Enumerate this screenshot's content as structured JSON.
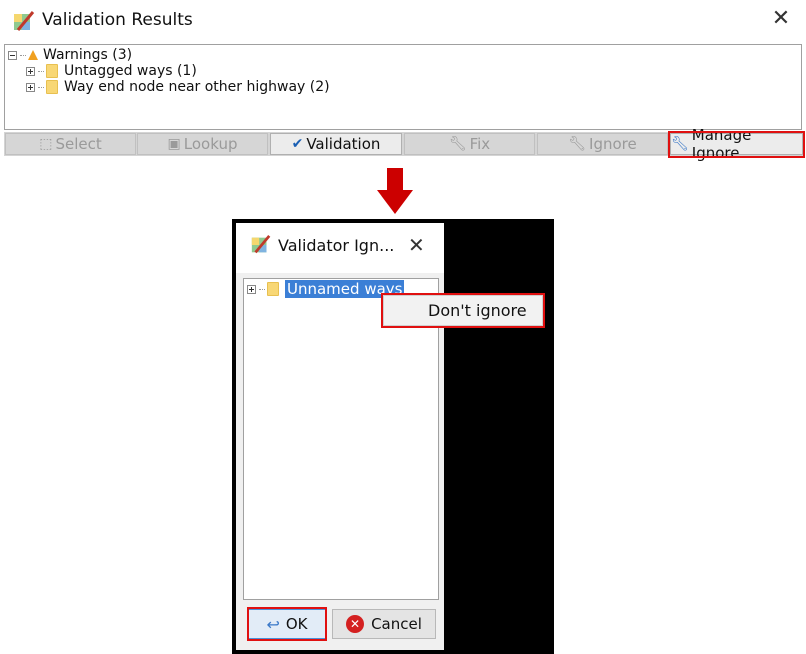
{
  "validation_window": {
    "title": "Validation Results",
    "close_icon": "close-icon",
    "tree": {
      "root": {
        "label": "Warnings (3)",
        "icon": "warning-icon",
        "expanded": true
      },
      "children": [
        {
          "label": "Untagged ways (1)",
          "icon": "folder-icon",
          "expanded": false
        },
        {
          "label": "Way end node near other highway (2)",
          "icon": "folder-icon",
          "expanded": false
        }
      ]
    },
    "toolbar": [
      {
        "label": "Select",
        "icon": "select-icon",
        "enabled": false
      },
      {
        "label": "Lookup",
        "icon": "lookup-icon",
        "enabled": false
      },
      {
        "label": "Validation",
        "icon": "checkmark-icon",
        "enabled": true
      },
      {
        "label": "Fix",
        "icon": "wrench-icon",
        "enabled": false
      },
      {
        "label": "Ignore",
        "icon": "wrench-icon",
        "enabled": false
      },
      {
        "label": "Manage Ignore",
        "icon": "wrench-icon",
        "enabled": true,
        "highlighted": true
      }
    ]
  },
  "arrow": {
    "icon": "down-arrow-icon",
    "color": "#cc0000"
  },
  "ignore_dialog": {
    "title": "Validator Ign...",
    "close_icon": "close-icon",
    "tree": [
      {
        "label": "Unnamed ways",
        "icon": "folder-icon",
        "selected": true,
        "expanded": false
      }
    ],
    "context_menu": [
      {
        "label": "Don't ignore",
        "highlighted": true
      }
    ],
    "buttons": {
      "ok_label": "OK",
      "cancel_label": "Cancel"
    }
  },
  "colors": {
    "highlight_box": "#e01010",
    "selection": "#3b7fd6"
  }
}
